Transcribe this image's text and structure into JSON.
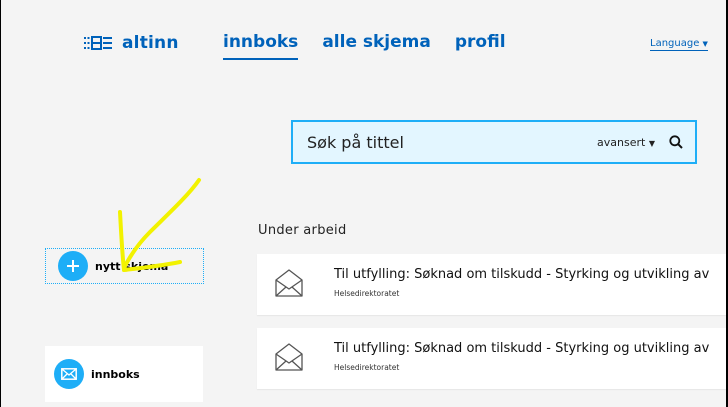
{
  "header": {
    "logo_text": "altinn",
    "nav": [
      {
        "label": "innboks",
        "active": true
      },
      {
        "label": "alle skjema",
        "active": false
      },
      {
        "label": "profil",
        "active": false
      }
    ],
    "language_label": "Language"
  },
  "search": {
    "placeholder": "Søk på tittel",
    "advanced_label": "avansert"
  },
  "sidebar": {
    "new_form_label": "nytt skjema",
    "inbox_label": "innboks"
  },
  "main": {
    "section_title": "Under arbeid",
    "items": [
      {
        "title": "Til utfylling: Søknad om tilskudd - Styrking og utvikling av",
        "subtitle": "Helsedirektoratet",
        "icon": "envelope-open-icon"
      },
      {
        "title": "Til utfylling: Søknad om tilskudd - Styrking og utvikling av",
        "subtitle": "Helsedirektoratet",
        "icon": "envelope-open-icon"
      }
    ]
  },
  "colors": {
    "brand_blue": "#0062ba",
    "accent_blue": "#1eaef7",
    "search_bg": "#e3f6ff",
    "annotation_yellow": "#f2f200"
  }
}
